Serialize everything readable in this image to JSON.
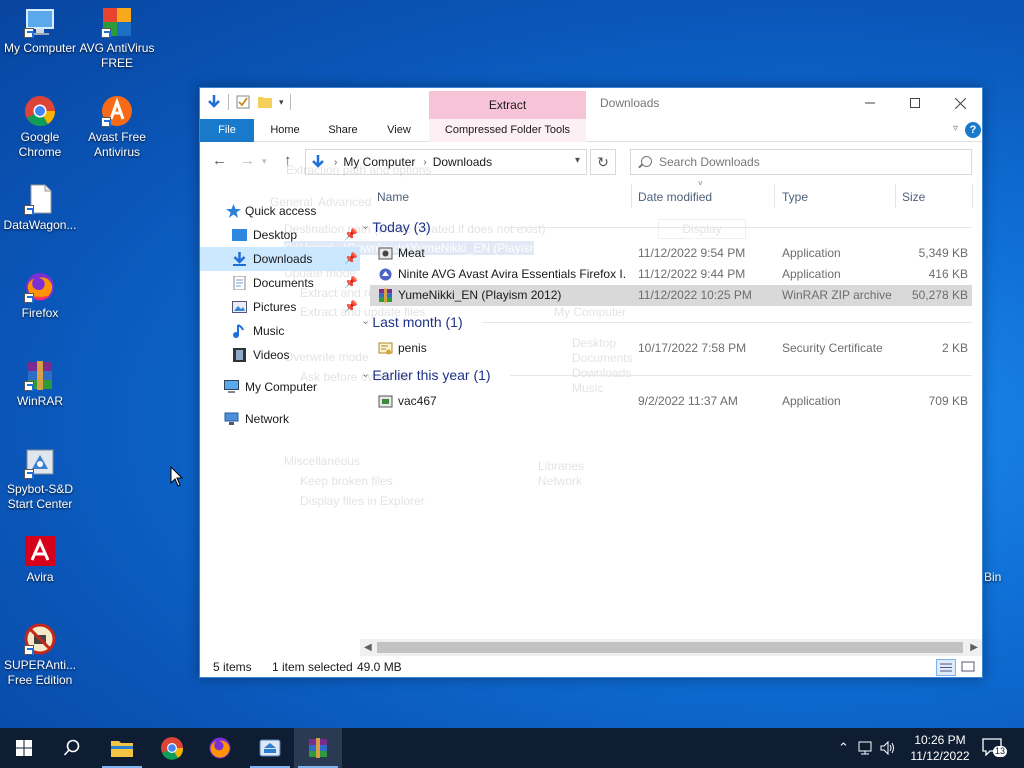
{
  "desktop": {
    "icons": [
      {
        "label": "My Computer"
      },
      {
        "label": "AVG AntiVirus FREE"
      },
      {
        "label": "Google Chrome"
      },
      {
        "label": "Avast Free Antivirus"
      },
      {
        "label": "DataWagon..."
      },
      {
        "label": "Firefox"
      },
      {
        "label": "WinRAR"
      },
      {
        "label": "Spybot-S&D Start Center"
      },
      {
        "label": "Avira"
      },
      {
        "label": "SUPERAnti... Free Edition"
      }
    ],
    "recycle_bin_partial": "Bin"
  },
  "window": {
    "title": "Downloads",
    "context_tab_label": "Extract",
    "ribbon_tabs": {
      "file": "File",
      "home": "Home",
      "share": "Share",
      "view": "View",
      "compressed": "Compressed Folder Tools"
    },
    "address": {
      "crumbs": [
        "My Computer",
        "Downloads"
      ]
    },
    "search": {
      "placeholder": "Search Downloads"
    },
    "nav": {
      "quick_access": "Quick access",
      "desktop": "Desktop",
      "downloads": "Downloads",
      "documents": "Documents",
      "pictures": "Pictures",
      "music": "Music",
      "videos": "Videos",
      "my_computer": "My Computer",
      "network": "Network"
    },
    "columns": {
      "name": "Name",
      "date": "Date modified",
      "type": "Type",
      "size": "Size"
    },
    "groups": [
      {
        "label": "Today (3)"
      },
      {
        "label": "Last month (1)"
      },
      {
        "label": "Earlier this year (1)"
      }
    ],
    "files": [
      {
        "name": "Meat",
        "date": "11/12/2022 9:54 PM",
        "type": "Application",
        "size": "5,349 KB",
        "icon": "app-icon"
      },
      {
        "name": "Ninite AVG Avast Avira Essentials Firefox I...",
        "date": "11/12/2022 9:44 PM",
        "type": "Application",
        "size": "416 KB",
        "icon": "ninite-icon"
      },
      {
        "name": "YumeNikki_EN (Playism 2012)",
        "date": "11/12/2022 10:25 PM",
        "type": "WinRAR ZIP archive",
        "size": "50,278 KB",
        "icon": "winrar-archive-icon"
      },
      {
        "name": "penis",
        "date": "10/17/2022 7:58 PM",
        "type": "Security Certificate",
        "size": "2 KB",
        "icon": "certificate-icon"
      },
      {
        "name": "vac467",
        "date": "9/2/2022 11:37 AM",
        "type": "Application",
        "size": "709 KB",
        "icon": "app-icon"
      }
    ],
    "status": {
      "items": "5 items",
      "selected": "1 item selected",
      "size": "49.0 MB"
    }
  },
  "ghost_dialog": {
    "title": "Extraction path and options",
    "tab_general": "General",
    "tab_advanced": "Advanced",
    "dest_label": "Destination path (will be created if does not exist)",
    "dest_value": "C:\\Users\\...\\Downloads\\YumeNikki_EN (Playism 2012)",
    "display_btn": "Display",
    "update_mode": "Update mode",
    "opt1": "Extract and replace files",
    "opt2": "Extract and update files",
    "overwrite_mode": "Overwrite mode",
    "opt3": "Ask before overwrite",
    "misc": "Miscellaneous",
    "keep": "Keep broken files",
    "display_files": "Display files in Explorer",
    "tree": [
      "Desktop",
      "My Computer",
      "Desktop",
      "Documents",
      "Downloads",
      "Music",
      "Libraries",
      "Network"
    ]
  },
  "taskbar": {
    "time": "10:26 PM",
    "date": "11/12/2022",
    "notifications": "13"
  }
}
